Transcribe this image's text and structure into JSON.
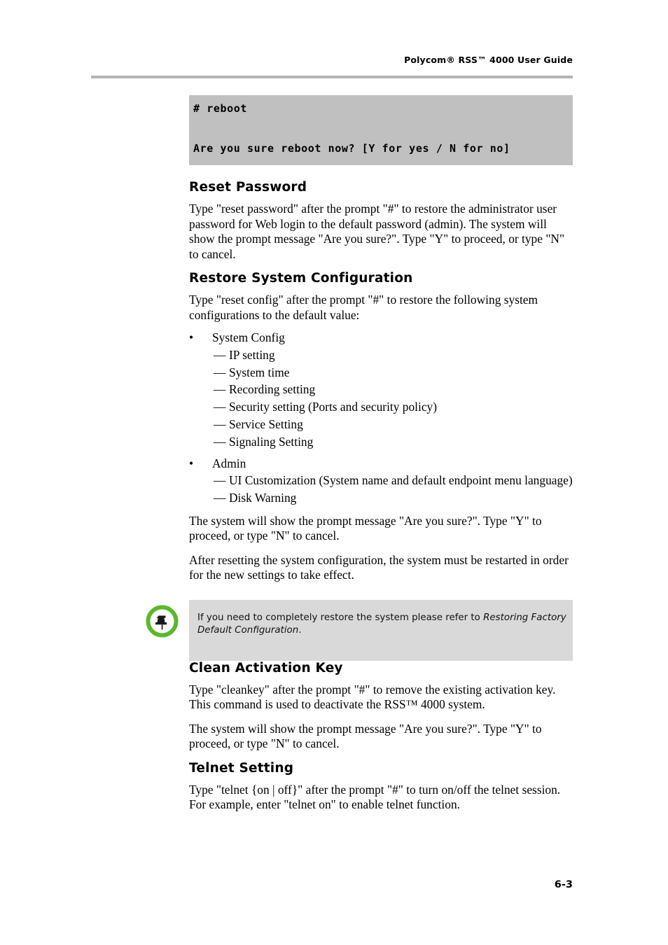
{
  "header": {
    "title": "Polycom® RSS™ 4000 User Guide"
  },
  "terminal": {
    "lines": [
      "# reboot",
      "",
      "",
      "Are you sure reboot now? [Y for yes / N for no]"
    ]
  },
  "sections": [
    {
      "heading": "Reset Password",
      "paragraphs": [
        "Type \"reset password\" after the prompt \"#\" to restore the administrator user password for Web login to the default password (admin). The system will show the prompt message \"Are you sure?\". Type \"Y\" to proceed, or type \"N\" to cancel."
      ]
    },
    {
      "heading": "Restore System Configuration",
      "intro": "Type \"reset config\" after the prompt \"#\" to restore the following system configurations to the default value:",
      "list": [
        {
          "marker": "•",
          "label": "System Config",
          "children": [
            {
              "marker": "—",
              "label": "IP setting"
            },
            {
              "marker": "—",
              "label": "System time"
            },
            {
              "marker": "—",
              "label": "Recording setting"
            },
            {
              "marker": "—",
              "label": "Security setting (Ports and security policy)"
            },
            {
              "marker": "—",
              "label": "Service Setting"
            },
            {
              "marker": "—",
              "label": "Signaling Setting"
            }
          ]
        },
        {
          "marker": "•",
          "label": "Admin",
          "children": [
            {
              "marker": "—",
              "label": "UI Customization (System name and default endpoint menu language)"
            },
            {
              "marker": "—",
              "label": "Disk Warning"
            }
          ]
        }
      ],
      "after_paragraphs": [
        "The system will show the prompt message \"Are you sure?\". Type \"Y\" to proceed, or type \"N\" to cancel.",
        "After resetting the system configuration, the system must be restarted in order for the new settings to take effect."
      ]
    },
    {
      "heading": "Clean Activation Key",
      "paragraphs": [
        "Type \"cleankey\" after the prompt \"#\" to remove the existing activation key. This command is used to deactivate the RSS™ 4000 system.",
        "The system will show the prompt message \"Are you sure?\". Type \"Y\" to proceed, or type \"N\" to cancel."
      ]
    },
    {
      "heading": "Telnet Setting",
      "paragraphs": [
        "Type \"telnet {on | off}\" after the prompt \"#\" to turn on/off the telnet session. For example, enter \"telnet on\" to enable telnet function."
      ]
    }
  ],
  "note": {
    "icon": "note-pushpin-icon",
    "text_before": "If you need to completely restore the system please refer to ",
    "text_emphasis": "Restoring Factory Default Configuration",
    "text_after": "."
  },
  "footer": {
    "page_number": "6-3"
  },
  "colors": {
    "terminal_bg": "#c0c0c0",
    "note_bg": "#d9d9d9",
    "rule": "#b4b4b4",
    "icon_green": "#5cb82e"
  }
}
